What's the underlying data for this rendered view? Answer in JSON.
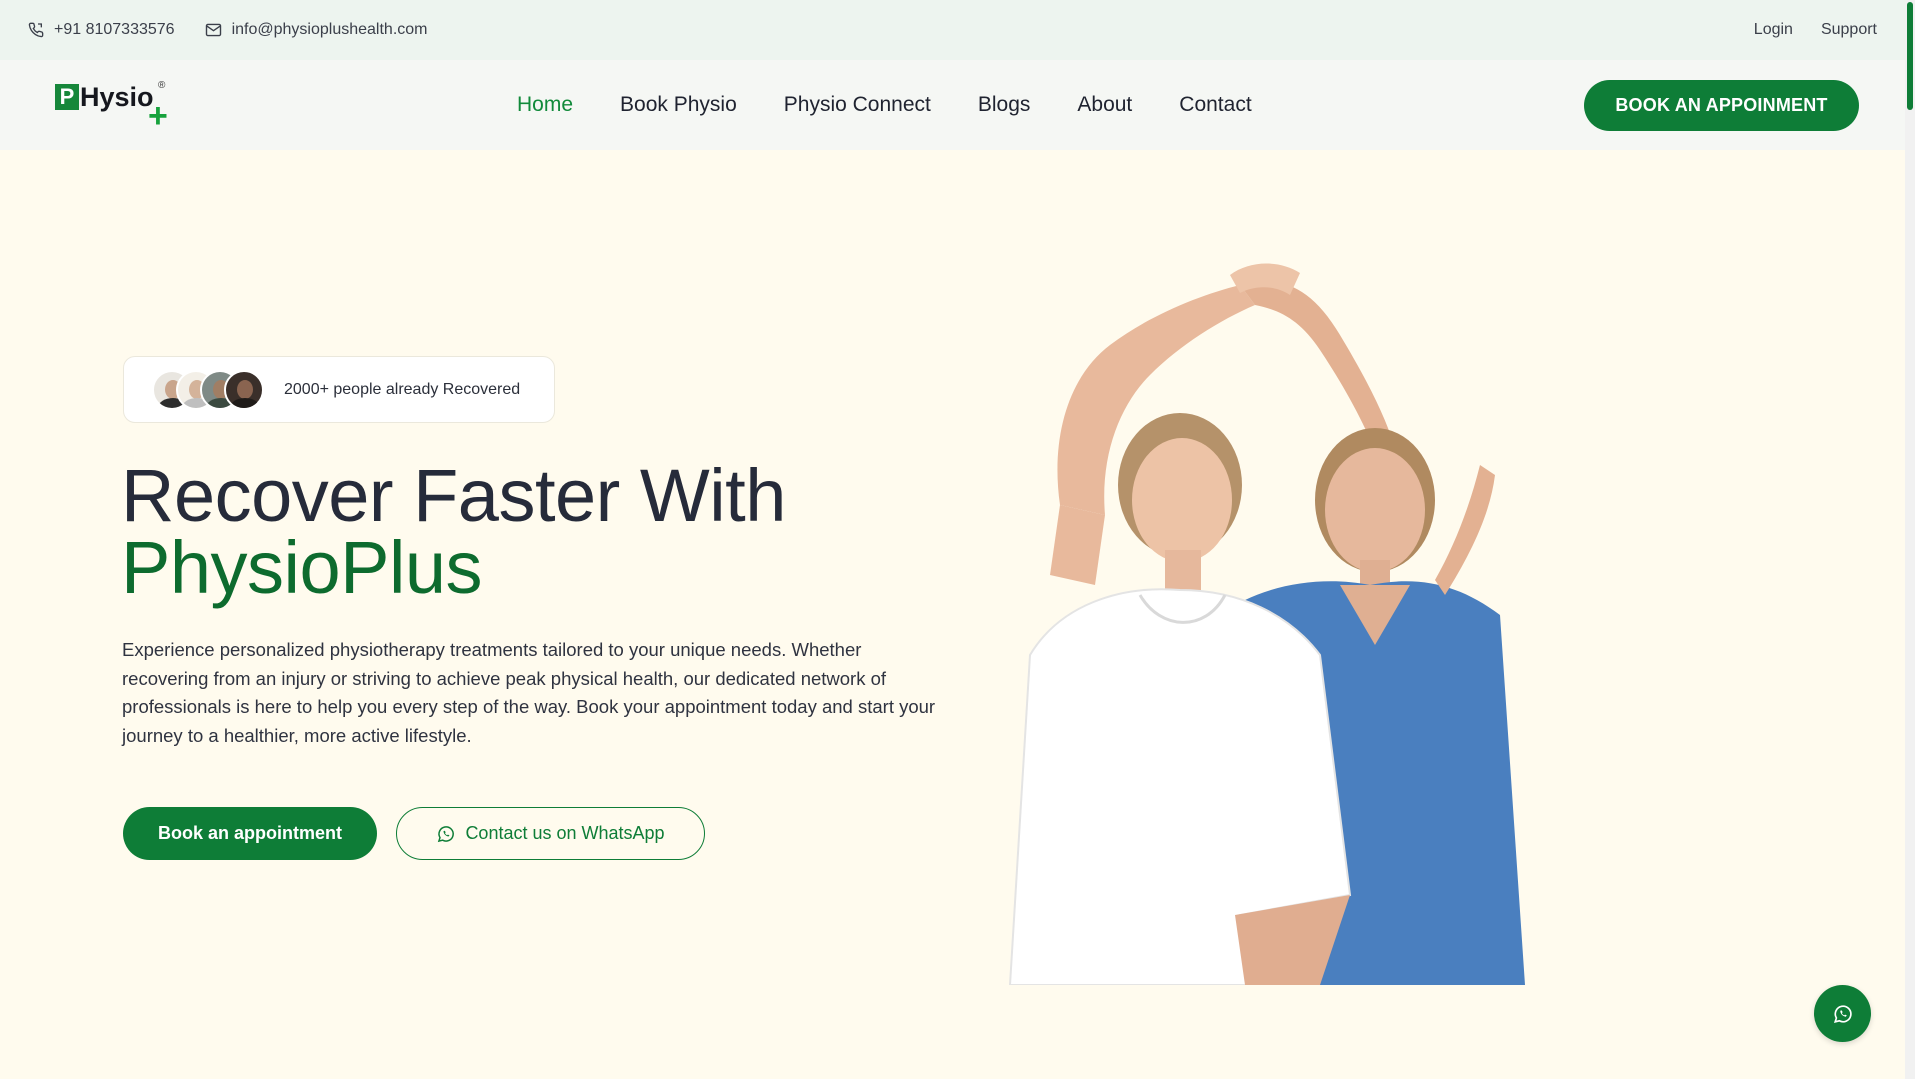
{
  "topbar": {
    "phone": "+91 8107333576",
    "email": "info@physioplushealth.com",
    "login": "Login",
    "support": "Support"
  },
  "logo": {
    "letter": "P",
    "text": "Hysio",
    "plus": "+",
    "registered": "®"
  },
  "nav": {
    "items": [
      {
        "label": "Home",
        "active": true
      },
      {
        "label": "Book Physio"
      },
      {
        "label": "Physio Connect"
      },
      {
        "label": "Blogs"
      },
      {
        "label": "About"
      },
      {
        "label": "Contact"
      }
    ],
    "cta": "BOOK AN APPOINMENT"
  },
  "hero": {
    "badge_text": "2000+ people already Recovered",
    "headline_line1": "Recover Faster With",
    "headline_line2": "PhysioPlus",
    "description": "Experience personalized physiotherapy treatments tailored to your unique needs. Whether recovering from an injury or striving to achieve peak physical health, our dedicated network of professionals is here to help you every step of the way. Book your appointment today and start your journey to a healthier, more active lifestyle.",
    "primary_button": "Book an appointment",
    "secondary_button": "Contact us on WhatsApp"
  },
  "colors": {
    "brand_green": "#0e7d37",
    "headline_green": "#0d6b2e",
    "background": "#fffbee",
    "topbar_bg": "#edf4ef"
  },
  "icons": {
    "phone": "phone-icon",
    "email": "mail-icon",
    "whatsapp": "whatsapp-icon"
  }
}
